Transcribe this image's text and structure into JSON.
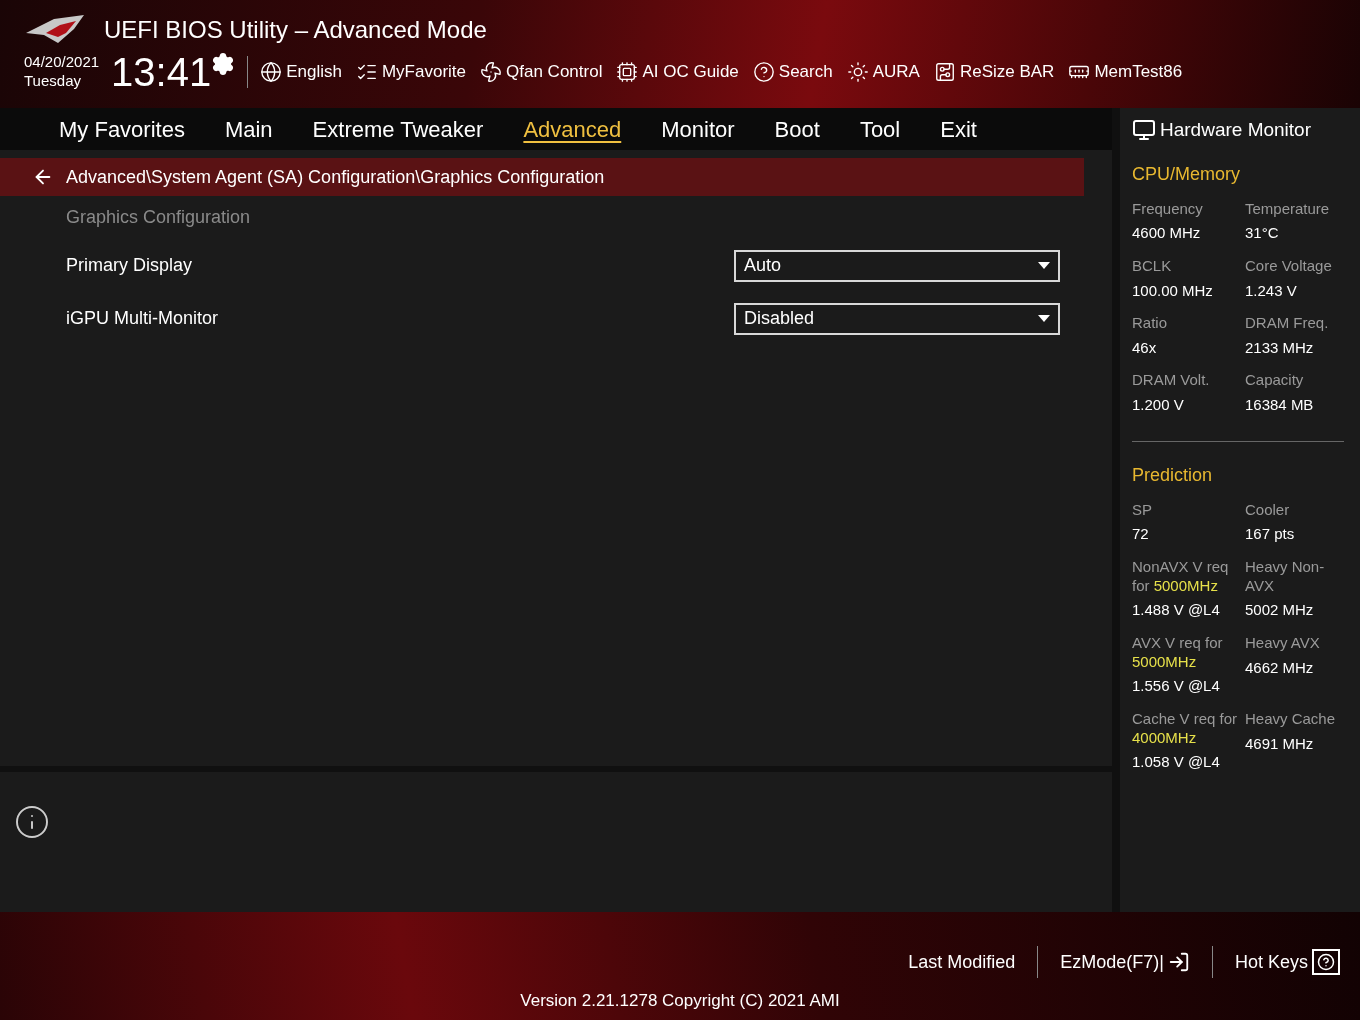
{
  "header": {
    "title": "UEFI BIOS Utility – Advanced Mode",
    "date": "04/20/2021",
    "weekday": "Tuesday",
    "time": "13:41",
    "tools": [
      {
        "kind": "language",
        "label": "English"
      },
      {
        "kind": "favorite",
        "label": "MyFavorite"
      },
      {
        "kind": "fan",
        "label": "Qfan Control"
      },
      {
        "kind": "chip",
        "label": "AI OC Guide"
      },
      {
        "kind": "search",
        "label": "Search"
      },
      {
        "kind": "light",
        "label": "AURA"
      },
      {
        "kind": "card",
        "label": "ReSize BAR"
      },
      {
        "kind": "memory",
        "label": "MemTest86"
      }
    ]
  },
  "tabs": [
    {
      "label": "My Favorites",
      "selected": false
    },
    {
      "label": "Main",
      "selected": false
    },
    {
      "label": "Extreme Tweaker",
      "selected": false
    },
    {
      "label": "Advanced",
      "selected": true
    },
    {
      "label": "Monitor",
      "selected": false
    },
    {
      "label": "Boot",
      "selected": false
    },
    {
      "label": "Tool",
      "selected": false
    },
    {
      "label": "Exit",
      "selected": false
    }
  ],
  "breadcrumb": "Advanced\\System Agent (SA) Configuration\\Graphics Configuration",
  "settings": [
    {
      "kind": "heading",
      "label": "Graphics Configuration"
    },
    {
      "kind": "dropdown",
      "label": "Primary Display",
      "value": "Auto"
    },
    {
      "kind": "dropdown",
      "label": "iGPU Multi-Monitor",
      "value": "Disabled"
    }
  ],
  "hardware_monitor": {
    "title": "Hardware Monitor",
    "sections": [
      {
        "title": "CPU/Memory",
        "items": [
          {
            "label": "Frequency",
            "value": "4600 MHz"
          },
          {
            "label": "Temperature",
            "value": "31°C"
          },
          {
            "label": "BCLK",
            "value": "100.00 MHz"
          },
          {
            "label": "Core Voltage",
            "value": "1.243 V"
          },
          {
            "label": "Ratio",
            "value": "46x"
          },
          {
            "label": "DRAM Freq.",
            "value": "2133 MHz"
          },
          {
            "label": "DRAM Volt.",
            "value": "1.200 V"
          },
          {
            "label": "Capacity",
            "value": "16384 MB"
          }
        ]
      },
      {
        "title": "Prediction",
        "items": [
          {
            "label": "SP",
            "value": "72"
          },
          {
            "label": "Cooler",
            "value": "167 pts"
          },
          {
            "label": "NonAVX V req for **5000MHz**",
            "value": "1.488 V @L4"
          },
          {
            "label": "Heavy Non-AVX",
            "value": "5002 MHz"
          },
          {
            "label": "AVX V req for **5000MHz**",
            "value": "1.556 V @L4"
          },
          {
            "label": "Heavy AVX",
            "value": "4662 MHz"
          },
          {
            "label": "Cache V req for **4000MHz**",
            "value": "1.058 V @L4"
          },
          {
            "label": "Heavy Cache",
            "value": "4691 MHz"
          }
        ]
      }
    ]
  },
  "footer": {
    "buttons": [
      {
        "kind": "text",
        "label": "Last Modified"
      },
      {
        "kind": "exit",
        "label": "EzMode(F7)|"
      },
      {
        "kind": "help",
        "label": "Hot Keys"
      }
    ],
    "version": "Version 2.21.1278 Copyright (C) 2021 AMI"
  }
}
